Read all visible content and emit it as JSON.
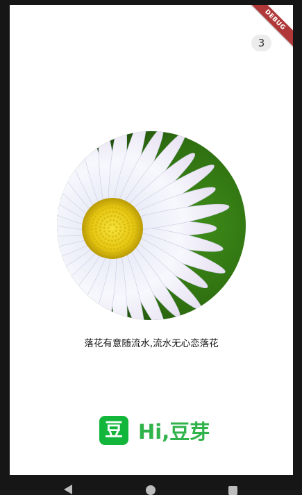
{
  "debug_banner": {
    "label": "DEBUG"
  },
  "counter": {
    "value": "3"
  },
  "image": {
    "subject": "daisy-flower"
  },
  "poem": {
    "text": "落花有意随流水,流水无心恋落花"
  },
  "brand": {
    "logo_char": "豆",
    "title": "Hi,豆芽",
    "color": "#2fb34a",
    "logo_color": "#12b63a"
  },
  "nav": {
    "back_icon": "back-triangle-icon",
    "home_icon": "home-circle-icon",
    "recents_icon": "recents-square-icon"
  }
}
